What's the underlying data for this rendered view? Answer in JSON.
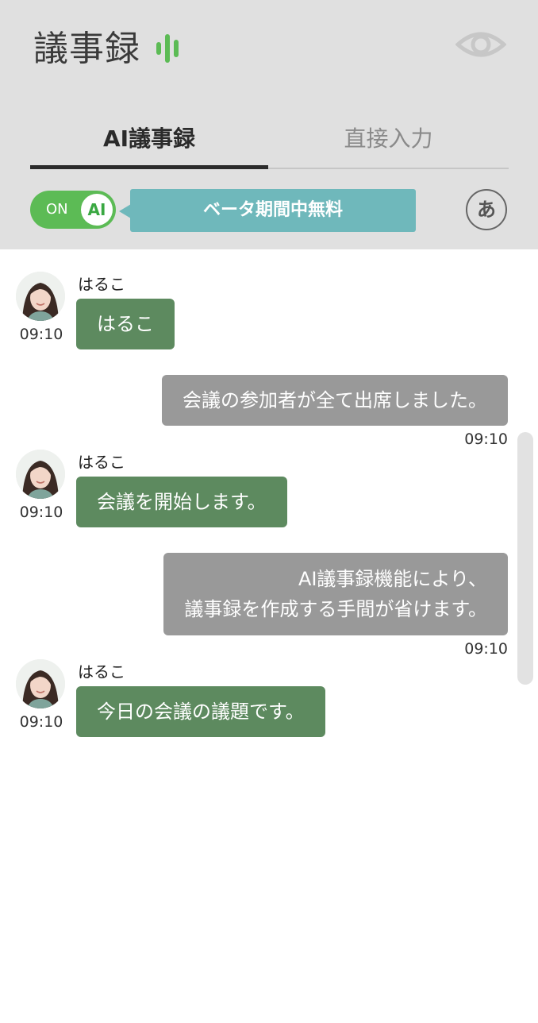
{
  "header": {
    "title": "議事録"
  },
  "tabs": {
    "ai": "AI議事録",
    "direct": "直接入力"
  },
  "toggle": {
    "on_label": "ON",
    "ai_label": "AI"
  },
  "beta_banner": "ベータ期間中無料",
  "kana_button": "あ",
  "colors": {
    "header_bg": "#e0e0e0",
    "toggle_on": "#5cbb55",
    "banner": "#6fb8bb",
    "incoming_bubble": "#5d8a5f",
    "outgoing_bubble": "#999999",
    "wave_icon": "#5cbb55"
  },
  "icons": {
    "wave": "audio-wave-icon",
    "eye": "eye-icon"
  },
  "messages": [
    {
      "direction": "incoming",
      "sender": "はるこ",
      "time": "09:10",
      "lines": [
        "はるこ"
      ]
    },
    {
      "direction": "outgoing",
      "time": "09:10",
      "lines": [
        "会議の参加者が全て出席しました。"
      ]
    },
    {
      "direction": "incoming",
      "sender": "はるこ",
      "time": "09:10",
      "lines": [
        "会議を開始します。"
      ]
    },
    {
      "direction": "outgoing",
      "time": "09:10",
      "lines": [
        "AI議事録機能により、",
        "議事録を作成する手間が省けます。"
      ]
    },
    {
      "direction": "incoming",
      "sender": "はるこ",
      "time": "09:10",
      "lines": [
        "今日の会議の議題です。"
      ]
    }
  ]
}
